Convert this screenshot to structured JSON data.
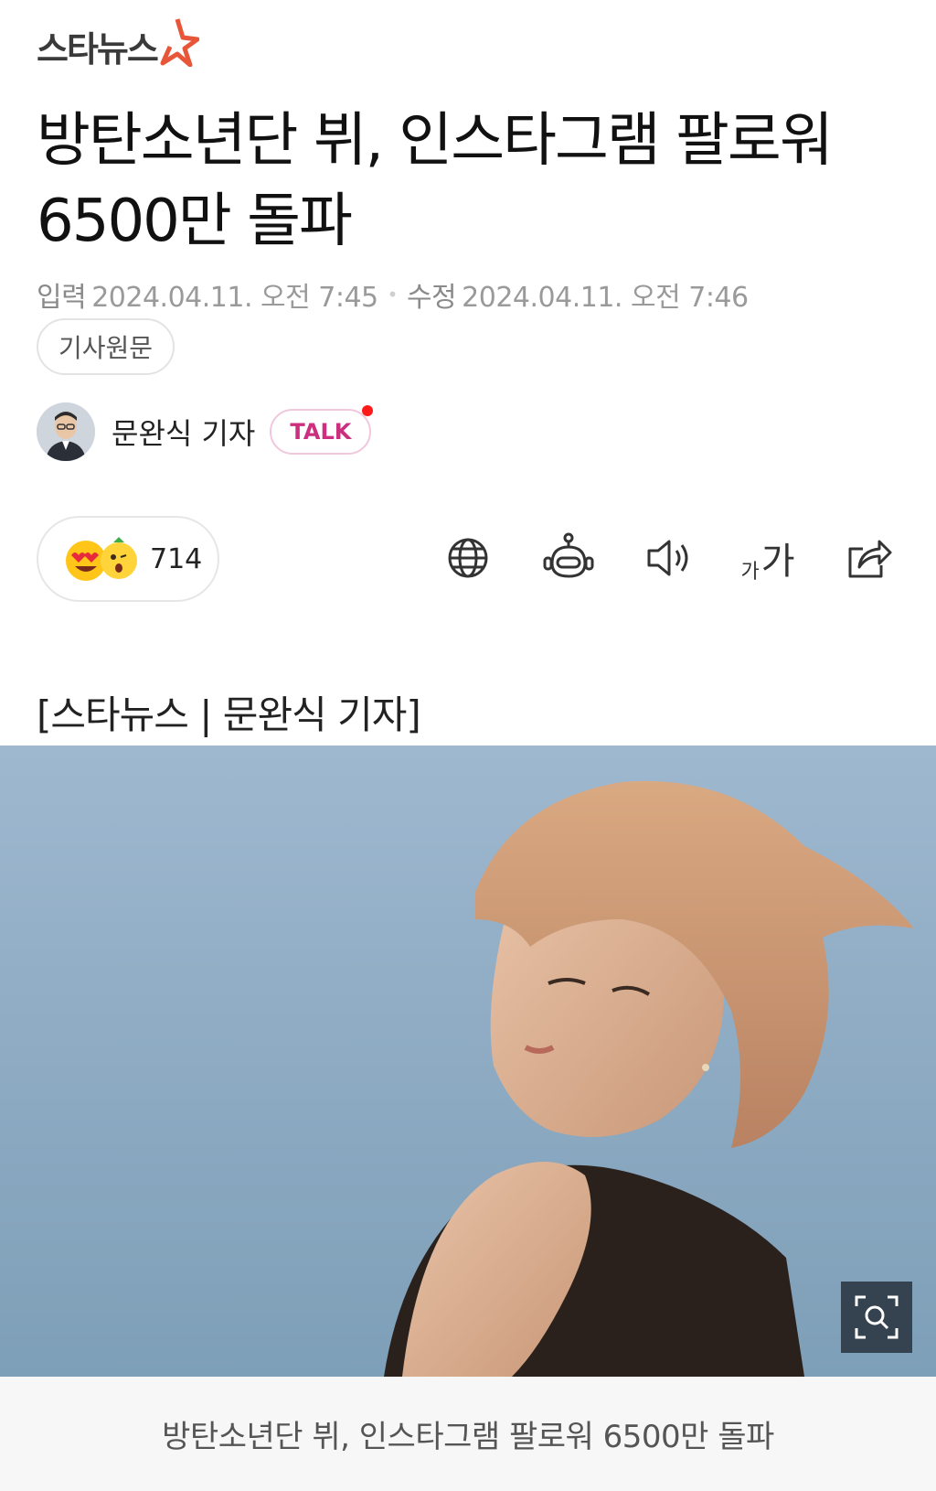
{
  "brand": {
    "logo_text": "스타뉴스",
    "accent_color": "#e8563a"
  },
  "article": {
    "title": "방탄소년단 뷔, 인스타그램 팔로워 6500만 돌파",
    "input_label": "입력",
    "input_time": "2024.04.11. 오전 7:45",
    "modified_label": "수정",
    "modified_time": "2024.04.11. 오전 7:46",
    "original_button": "기사원문",
    "byline": "[스타뉴스 | 문완식 기자]",
    "caption": "방탄소년단 뷔, 인스타그램 팔로워 6500만 돌파"
  },
  "reporter": {
    "name": "문완식 기자",
    "talk_label": "TALK",
    "talk_color": "#cc2f7d"
  },
  "reactions": {
    "count": "714"
  },
  "toolbar": {
    "font_small": "가",
    "font_large": "가",
    "icons": [
      "globe-icon",
      "robot-icon",
      "speaker-icon",
      "font-size-icon",
      "share-icon"
    ]
  }
}
